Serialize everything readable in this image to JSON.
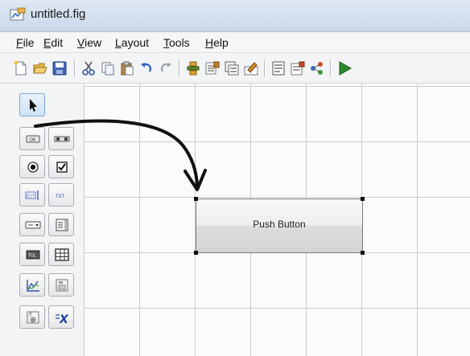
{
  "window": {
    "title": "untitled.fig"
  },
  "menu": [
    {
      "key": "F",
      "rest": "ile"
    },
    {
      "key": "E",
      "rest": "dit"
    },
    {
      "key": "V",
      "rest": "iew"
    },
    {
      "key": "L",
      "rest": "ayout"
    },
    {
      "key": "T",
      "rest": "ools"
    },
    {
      "key": "H",
      "rest": "elp"
    }
  ],
  "toolbar_icons": [
    "new-file-icon",
    "open-folder-icon",
    "save-icon",
    "cut-icon",
    "copy-icon",
    "paste-icon",
    "undo-icon",
    "redo-icon",
    "align-objects-icon",
    "menu-editor-icon",
    "tab-order-icon",
    "toolbar-editor-icon",
    "editor-icon",
    "property-inspector-icon",
    "object-browser-icon",
    "run-figure-icon"
  ],
  "palette_tools": [
    "select-tool-icon",
    "push-button-tool-icon",
    "slider-tool-icon",
    "radio-button-tool-icon",
    "checkbox-tool-icon",
    "edit-text-tool-icon",
    "static-text-tool-icon",
    "popup-menu-tool-icon",
    "listbox-tool-icon",
    "toggle-button-tool-icon",
    "table-tool-icon",
    "axes-tool-icon",
    "panel-tool-icon",
    "button-group-tool-icon",
    "activex-control-tool-icon"
  ],
  "canvas": {
    "push_button": {
      "label": "Push Button"
    }
  },
  "colors": {
    "accent": "#2b8a2b",
    "title_bg": "#dfe8f3",
    "grid": "#c9ccd0"
  }
}
